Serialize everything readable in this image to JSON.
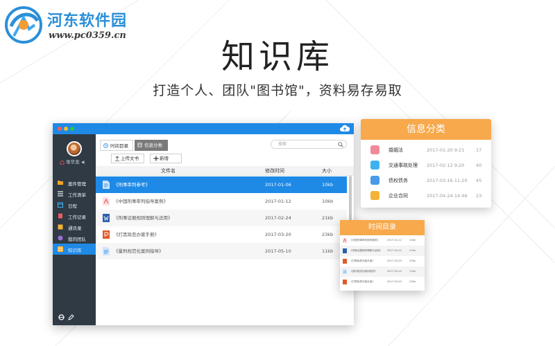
{
  "watermark": {
    "site_name": "河东软件园",
    "url": "www.pc0359.cn"
  },
  "hero": {
    "title": "知识库",
    "subtitle": "打造个人、团队\"图书馆\"，资料易存易取"
  },
  "app": {
    "user_name": "张华龙",
    "nav": [
      {
        "label": "案件管理",
        "icon": "folder-icon",
        "active": false
      },
      {
        "label": "工作清单",
        "icon": "list-icon",
        "active": false
      },
      {
        "label": "日程",
        "icon": "calendar-icon",
        "active": false
      },
      {
        "label": "工作记录",
        "icon": "file-icon",
        "active": false
      },
      {
        "label": "通讯录",
        "icon": "contacts-icon",
        "active": false
      },
      {
        "label": "我的团队",
        "icon": "team-icon",
        "active": false
      },
      {
        "label": "知识库",
        "icon": "grid-icon",
        "active": true
      }
    ],
    "tabs": [
      {
        "label": "时间目录",
        "icon": "clock-icon"
      },
      {
        "label": "信息分类",
        "icon": "category-icon"
      }
    ],
    "search_placeholder": "搜索",
    "buttons": {
      "upload": "上传文书",
      "add": "新增"
    },
    "table": {
      "columns": [
        "文件名",
        "修改时间",
        "大小"
      ],
      "rows": [
        {
          "name": "《刑事审判参考》",
          "date": "2017-01-06",
          "size": "10kb",
          "icon": "doc-icon",
          "selected": true
        },
        {
          "name": "《中国刑事审判指导案例》",
          "date": "2017-01-12",
          "size": "10kb",
          "icon": "pdf-icon",
          "selected": false
        },
        {
          "name": "《刑事证据规则理解与适用》",
          "date": "2017-02-24",
          "size": "21kb",
          "icon": "word-icon",
          "selected": false
        },
        {
          "name": "《打黑除恶办案手册》",
          "date": "2017-03-20",
          "size": "23kb",
          "icon": "ppt-icon",
          "selected": false
        },
        {
          "name": "《量刑规范化案例指导》",
          "date": "2017-05-10",
          "size": "11kb",
          "icon": "doc-icon",
          "selected": false
        }
      ]
    }
  },
  "info_card": {
    "title": "信息分类",
    "items": [
      {
        "name": "婚姻法",
        "date": "2017-01-20 9:21",
        "count": "17",
        "color": "#f08a9a"
      },
      {
        "name": "交通事故处理",
        "date": "2017-02-12 9:20",
        "count": "40",
        "color": "#3eb2f0"
      },
      {
        "name": "债权债务",
        "date": "2017-03-16 11:20",
        "count": "45",
        "color": "#4a9ae8"
      },
      {
        "name": "企业合同",
        "date": "2017-04-24 14:46",
        "count": "23",
        "color": "#f5b335"
      }
    ]
  },
  "time_card": {
    "title": "时间目录",
    "rows": [
      {
        "name": "《中国刑事审判指导案例》",
        "date": "2017-01-12",
        "size": "10kb",
        "icon": "pdf-icon"
      },
      {
        "name": "《刑事证据规则理解与适用》",
        "date": "2017-02-24",
        "size": "21kb",
        "icon": "word-icon"
      },
      {
        "name": "《打黑除恶办案手册》",
        "date": "2017-03-20",
        "size": "23kb",
        "icon": "ppt-icon"
      },
      {
        "name": "《量刑规范化案例指导》",
        "date": "2017-05-10",
        "size": "11kb",
        "icon": "doc-icon"
      },
      {
        "name": "《打黑除恶办案手册》",
        "date": "2017-03-20",
        "size": "23kb",
        "icon": "ppt-icon"
      }
    ]
  },
  "colors": {
    "accent": "#1f8ae6",
    "sidebar": "#2f3a44",
    "card_header": "#f7a94b"
  }
}
